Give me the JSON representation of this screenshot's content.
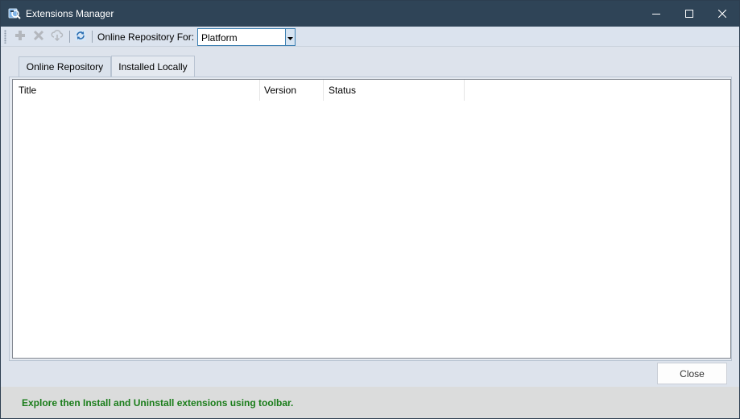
{
  "window": {
    "title": "Extensions Manager",
    "icon": "extensions-app-icon"
  },
  "title_controls": {
    "minimize_icon": "minimize-icon",
    "maximize_icon": "maximize-icon",
    "close_icon": "close-icon"
  },
  "toolbar": {
    "add_icon": "plus-icon",
    "remove_icon": "x-icon",
    "download_icon": "cloud-download-icon",
    "refresh_icon": "refresh-icon",
    "repo_label": "Online Repository For:",
    "repo_selected": "Platform"
  },
  "tabs": [
    {
      "label": "Online Repository",
      "active": false
    },
    {
      "label": "Installed Locally",
      "active": true
    }
  ],
  "list": {
    "columns": [
      "Title",
      "Version",
      "Status"
    ],
    "rows": []
  },
  "footer": {
    "close_label": "Close",
    "status_message": "Explore then Install and Uninstall extensions using toolbar."
  },
  "colors": {
    "titlebar": "#2f4457",
    "status_text": "#1a7d1a",
    "accent_border": "#3c7fb1"
  }
}
